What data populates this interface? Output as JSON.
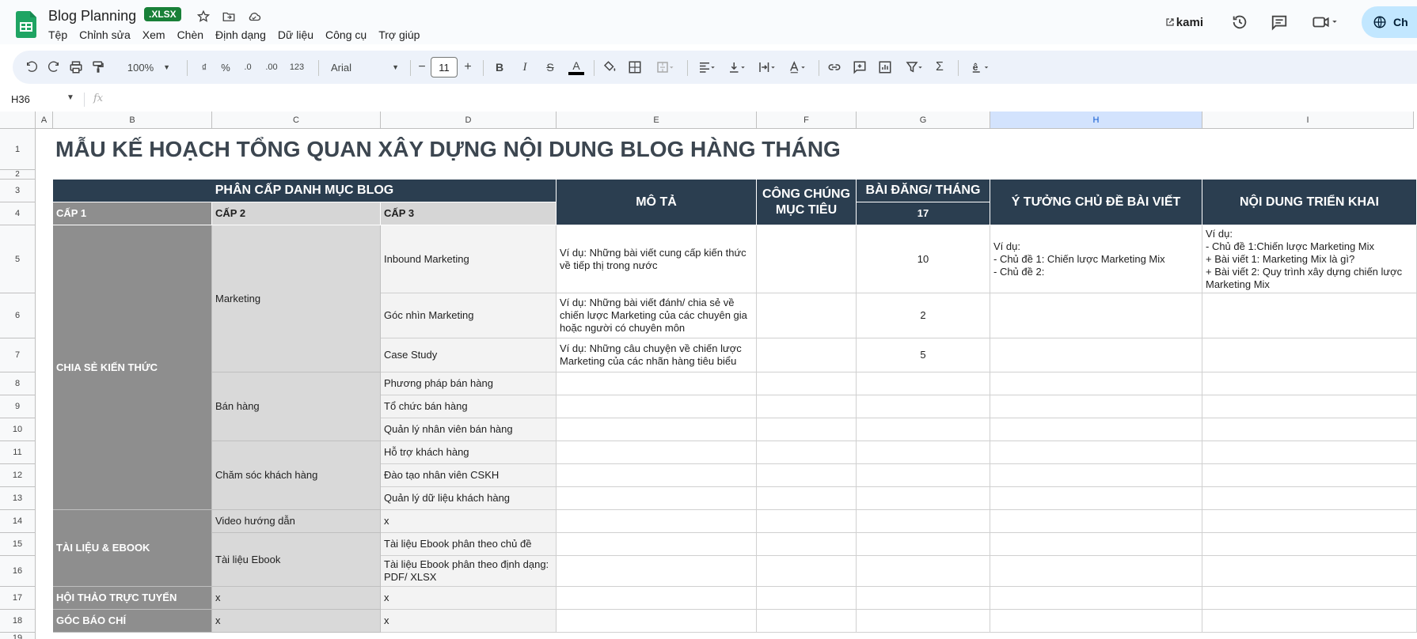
{
  "app": {
    "doc_title": "Blog Planning",
    "badge": ".XLSX",
    "menu": [
      "Tệp",
      "Chỉnh sửa",
      "Xem",
      "Chèn",
      "Định dạng",
      "Dữ liệu",
      "Công cụ",
      "Trợ giúp"
    ],
    "kami": "kami",
    "share_label": "Ch"
  },
  "toolbar": {
    "zoom": "100%",
    "currency": "₫",
    "percent": "%",
    "dec_dec": ".0",
    "dec_inc": ".00",
    "numfmt": "123",
    "font": "Arial",
    "font_size": "11",
    "bold": "B",
    "italic": "I",
    "strike": "S",
    "text_color": "A",
    "sum": "Σ"
  },
  "formula": {
    "namebox": "H36",
    "fx": "fx"
  },
  "columns": [
    "A",
    "B",
    "C",
    "D",
    "E",
    "F",
    "G",
    "H",
    "I"
  ],
  "rows": [
    "1",
    "2",
    "3",
    "4",
    "5",
    "6",
    "7",
    "8",
    "9",
    "10",
    "11",
    "12",
    "13",
    "14",
    "15",
    "16",
    "17",
    "18",
    "19"
  ],
  "sheet": {
    "title": "MẪU KẾ HOẠCH TỔNG QUAN XÂY DỰNG NỘI DUNG BLOG HÀNG THÁNG",
    "header": {
      "phan_cap": "PHÂN CẤP DANH MỤC BLOG",
      "cap1": "CẤP 1",
      "cap2": "CẤP 2",
      "cap3": "CẤP 3",
      "mo_ta": "MÔ TẢ",
      "cong_chung": "CÔNG CHÚNG MỤC TIÊU",
      "bai_dang": "BÀI ĐĂNG/ THÁNG",
      "bai_dang_total": "17",
      "y_tuong": "Ý TƯỞNG CHỦ ĐỀ BÀI VIẾT",
      "noi_dung": "NỘI DUNG TRIỂN KHAI"
    },
    "cap1": {
      "chia_se": "CHIA SẺ KIẾN THỨC",
      "tai_lieu": "TÀI LIỆU & EBOOK",
      "hoi_thao": "HỘI THẢO TRỰC TUYẾN",
      "goc_bao_chi": "GÓC BÁO CHÍ"
    },
    "cap2": {
      "marketing": "Marketing",
      "ban_hang": "Bán hàng",
      "cham_soc": "Chăm sóc khách hàng",
      "video": "Video hướng dẫn",
      "ebook": "Tài liệu Ebook",
      "hoi_thao": "x",
      "bao_chi": "x"
    },
    "cap3": {
      "r5": "Inbound Marketing",
      "r6": "Góc nhìn Marketing",
      "r7": "Case Study",
      "r8": "Phương pháp bán hàng",
      "r9": "Tổ chức bán hàng",
      "r10": "Quản lý nhân viên bán hàng",
      "r11": "Hỗ trợ khách hàng",
      "r12": "Đào tạo nhân viên CSKH",
      "r13": "Quản lý dữ liệu khách hàng",
      "r14": "x",
      "r15": "Tài liệu Ebook phân theo chủ đề",
      "r16": "Tài liệu Ebook phân theo định dạng: PDF/ XLSX",
      "r17": "x",
      "r18": "x"
    },
    "mo_ta": {
      "r5": "Ví dụ: Những bài viết cung cấp kiến thức về tiếp thị trong nước",
      "r6": "Ví dụ: Những bài viết đánh/ chia sẻ về chiến lược Marketing của các chuyên gia hoặc người có chuyên môn",
      "r7": "Ví dụ: Những câu chuyện về chiến lược Marketing của các nhãn hàng tiêu biểu"
    },
    "bai_dang": {
      "r5": "10",
      "r6": "2",
      "r7": "5"
    },
    "y_tuong": {
      "r5_l1": "Ví dụ:",
      "r5_l2": "- Chủ đề 1: Chiến lược Marketing Mix",
      "r5_l3": "- Chủ đề 2:"
    },
    "noi_dung": {
      "r5_l1": "Ví dụ:",
      "r5_l2": "- Chủ đề 1:Chiến lược Marketing Mix",
      "r5_l3": "+ Bài viết 1: Marketing Mix là gì?",
      "r5_l4": "+ Bài viết 2: Quy trình xây dựng chiến lược Marketing Mix"
    }
  }
}
